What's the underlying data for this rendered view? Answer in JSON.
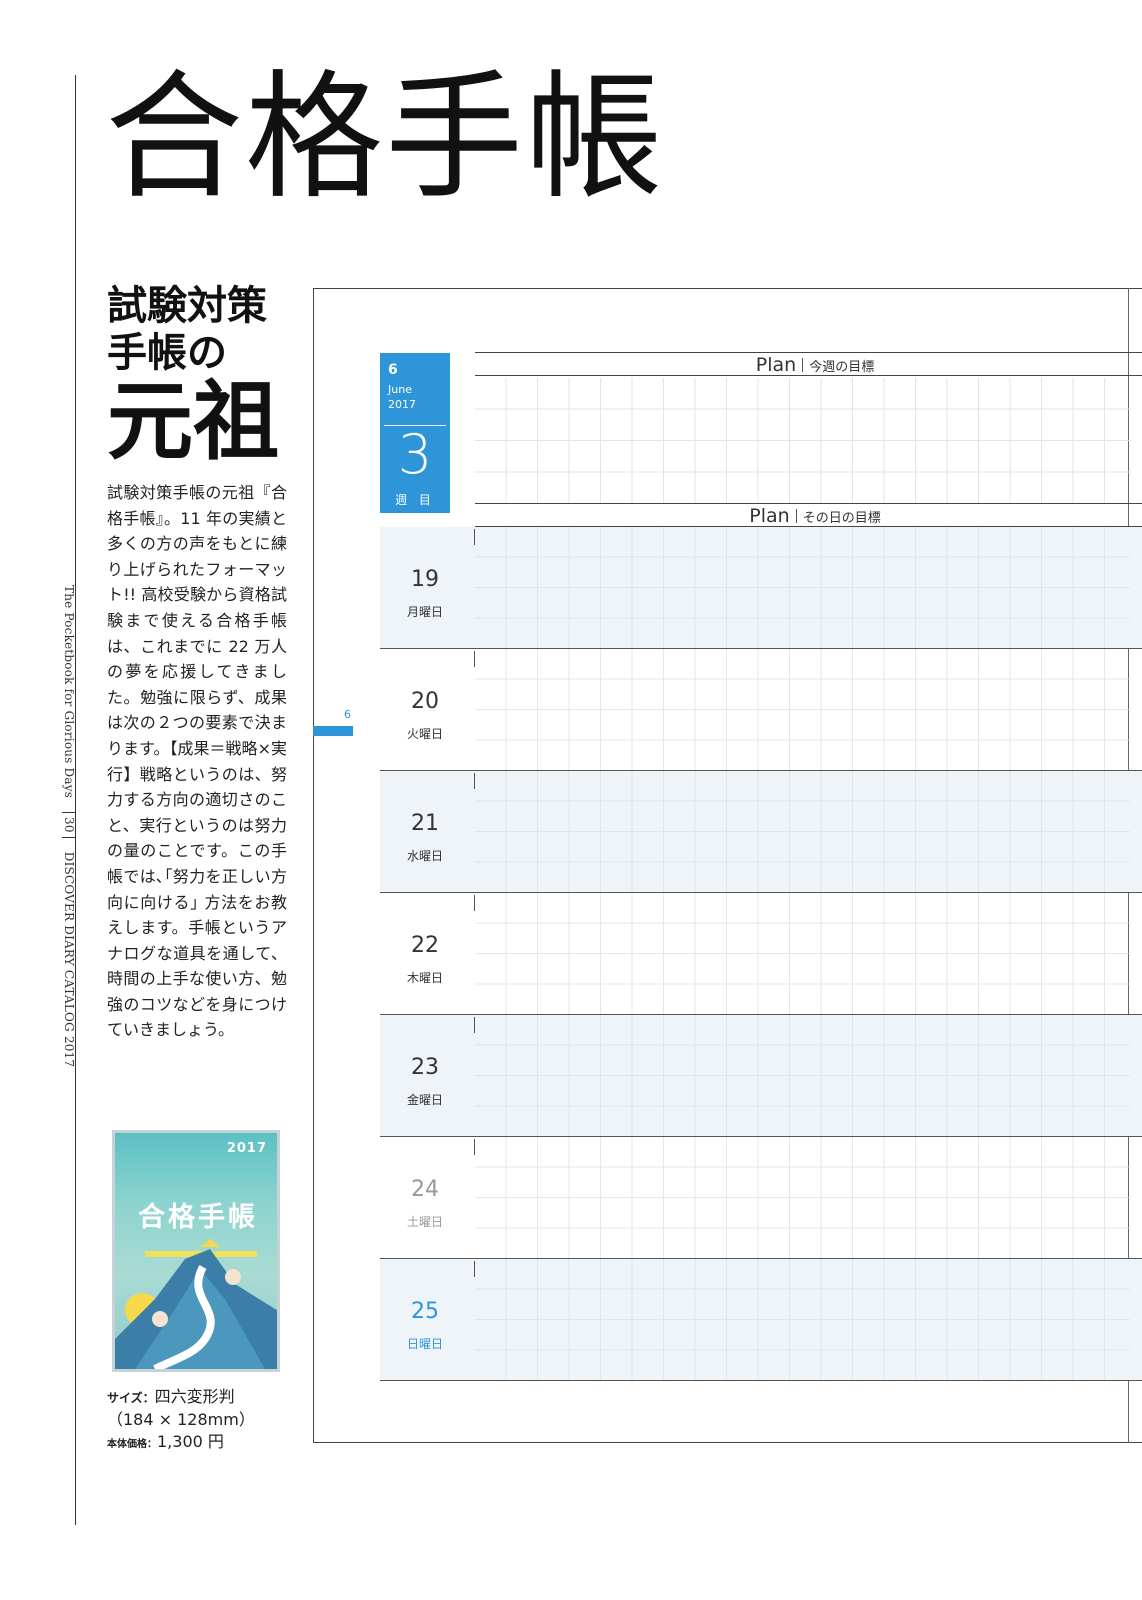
{
  "title": "合格手帳",
  "spine": {
    "left_text": "The Pocketbook for Glorious Days",
    "page_number": "30",
    "right_text": "DISCOVER DIARY CATALOG 2017"
  },
  "headline": {
    "line1": "試験対策",
    "line2": "手帳の",
    "line3": "元祖"
  },
  "body": "試験対策手帳の元祖『合格手帳』。11 年の実績と多くの方の声をもとに練り上げられたフォーマット!! 高校受験から資格試験まで使える合格手帳は、これまでに 22 万人の夢を応援してきました。勉強に限らず、成果は次の２つの要素で決まります。【成果＝戦略×実行】戦略というのは、努力する方向の適切さのこと、実行というのは努力の量のことです。この手帳では､｢努力を正しい方向に向ける｣ 方法をお教えします。手帳というアナログな道具を通して、時間の上手な使い方、勉強のコツなどを身につけていきましょう。",
  "book": {
    "year": "2017",
    "title": "合格手帳"
  },
  "specs": {
    "size_label": "サイズ：",
    "size_value": "四六変形判",
    "dimensions": "（184 × 128mm）",
    "price_label": "本体価格：",
    "price_value": "1,300 円"
  },
  "diary": {
    "side_tab": "6",
    "week": {
      "month_num": "6",
      "month_name": "June",
      "year": "2017",
      "week_number": "3",
      "week_label": "週 目"
    },
    "weekly_plan": {
      "label": "Plan",
      "sub": "今週の目標"
    },
    "daily_plan": {
      "label": "Plan",
      "sub": "その日の目標"
    },
    "days": [
      {
        "date": "19",
        "weekday": "月曜日"
      },
      {
        "date": "20",
        "weekday": "火曜日"
      },
      {
        "date": "21",
        "weekday": "水曜日"
      },
      {
        "date": "22",
        "weekday": "木曜日"
      },
      {
        "date": "23",
        "weekday": "金曜日"
      },
      {
        "date": "24",
        "weekday": "土曜日"
      },
      {
        "date": "25",
        "weekday": "日曜日"
      }
    ],
    "colors": {
      "accent": "#2d95d8",
      "shade": "#eef4f8",
      "saturday": "#999999"
    }
  }
}
